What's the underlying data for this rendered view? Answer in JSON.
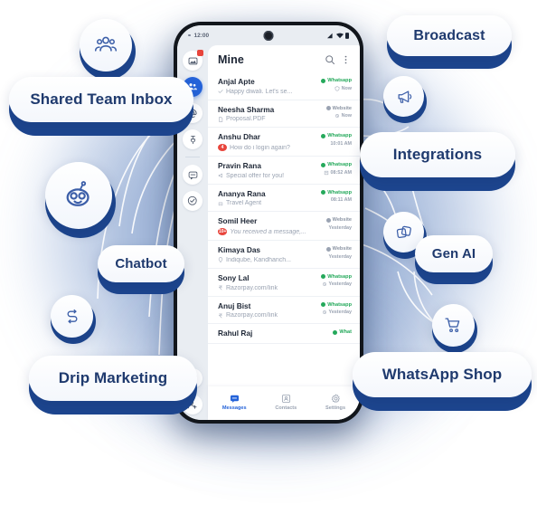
{
  "background": {
    "accent_navy": "#1d468f",
    "accent_blue": "#2563d9",
    "pill_text_color": "#1f3a6e",
    "whatsapp_green": "#25a95b"
  },
  "phone": {
    "statusbar": {
      "time": "12:00",
      "icons": [
        "signal-icon",
        "wifi-icon",
        "battery-icon"
      ]
    },
    "header": {
      "title": "Mine",
      "search_icon": "search-icon",
      "more_icon": "more-vertical-icon"
    },
    "rail": {
      "items": [
        {
          "icon": "inbox-icon",
          "active": false,
          "badge": true
        },
        {
          "icon": "team-contacts-icon",
          "active": true,
          "badge": false
        },
        {
          "icon": "at-mention-icon",
          "active": false,
          "badge": false
        },
        {
          "icon": "pin-icon",
          "active": false,
          "badge": false
        },
        {
          "icon": "chat-bubble-icon",
          "active": false,
          "badge": false
        },
        {
          "icon": "check-circle-icon",
          "active": false,
          "badge": false
        }
      ],
      "bottom_items": [
        {
          "icon": "filter-icon"
        },
        {
          "icon": "add-person-icon"
        }
      ]
    },
    "chats": [
      {
        "name": "Anjal Apte",
        "preview": "Happy diwali. Let's se...",
        "preview_icon": "double-check-icon",
        "channel": "Whatsapp",
        "channel_type": "whatsapp",
        "time": "Now",
        "time_icon": "shield-icon",
        "unread": "",
        "italic": false
      },
      {
        "name": "Neesha Sharma",
        "preview": "Proposal.PDF",
        "preview_icon": "document-icon",
        "channel": "Website",
        "channel_type": "website",
        "time": "Now",
        "time_icon": "clock-icon",
        "unread": "",
        "italic": false
      },
      {
        "name": "Anshu Dhar",
        "preview": "How do i login again?",
        "preview_icon": "",
        "channel": "Whatsapp",
        "channel_type": "whatsapp",
        "time": "10:01 AM",
        "time_icon": "",
        "unread": "4",
        "italic": false
      },
      {
        "name": "Pravin Rana",
        "preview": "Special offer for you!",
        "preview_icon": "megaphone-icon",
        "channel": "Whatsapp",
        "channel_type": "whatsapp",
        "time": "08:52 AM",
        "time_icon": "campaign-icon",
        "unread": "",
        "italic": false
      },
      {
        "name": "Ananya Rana",
        "preview": "Travel Agent",
        "preview_icon": "bot-icon",
        "channel": "Whatsapp",
        "channel_type": "whatsapp",
        "time": "08:11 AM",
        "time_icon": "",
        "unread": "",
        "italic": false
      },
      {
        "name": "Somil Heer",
        "preview": "You received a message,...",
        "preview_icon": "",
        "channel": "Website",
        "channel_type": "website",
        "time": "Yesterday",
        "time_icon": "",
        "unread": "10+",
        "italic": true
      },
      {
        "name": "Kimaya Das",
        "preview": "Indiqube, Kandhanch...",
        "preview_icon": "location-icon",
        "channel": "Website",
        "channel_type": "website",
        "time": "Yesterday",
        "time_icon": "",
        "unread": "",
        "italic": false
      },
      {
        "name": "Sony Lal",
        "preview": "Razorpay.com/link",
        "preview_icon": "rupee-icon",
        "channel": "Whatsapp",
        "channel_type": "whatsapp",
        "time": "Yesterday",
        "time_icon": "clock-icon",
        "unread": "",
        "italic": false
      },
      {
        "name": "Anuj Bist",
        "preview": "Razorpay.com/link",
        "preview_icon": "rupee-icon",
        "channel": "Whatsapp",
        "channel_type": "whatsapp",
        "time": "Yesterday",
        "time_icon": "clock-icon",
        "unread": "",
        "italic": false
      },
      {
        "name": "Rahul Raj",
        "preview": "",
        "preview_icon": "",
        "channel": "What",
        "channel_type": "whatsapp",
        "time": "",
        "time_icon": "",
        "unread": "",
        "italic": false
      }
    ],
    "bottom_nav": [
      {
        "label": "Messages",
        "icon": "messages-icon",
        "active": true
      },
      {
        "label": "Contacts",
        "icon": "contacts-icon",
        "active": false
      },
      {
        "label": "Settings",
        "icon": "settings-gear-icon",
        "active": false
      }
    ]
  },
  "features": {
    "pills": [
      {
        "label": "Shared Team Inbox",
        "id": "shared-team-inbox"
      },
      {
        "label": "Chatbot",
        "id": "chatbot"
      },
      {
        "label": "Drip Marketing",
        "id": "drip-marketing"
      },
      {
        "label": "Broadcast",
        "id": "broadcast"
      },
      {
        "label": "Integrations",
        "id": "integrations"
      },
      {
        "label": "Gen AI",
        "id": "gen-ai"
      },
      {
        "label": "WhatsApp Shop",
        "id": "whatsapp-shop"
      }
    ],
    "icon_bubbles": [
      {
        "id": "team-group-icon"
      },
      {
        "id": "robot-chatbot-icon"
      },
      {
        "id": "drip-flow-icon"
      },
      {
        "id": "megaphone-broadcast-icon"
      },
      {
        "id": "integrations-stack-icon"
      },
      {
        "id": "shopping-cart-icon"
      }
    ]
  }
}
